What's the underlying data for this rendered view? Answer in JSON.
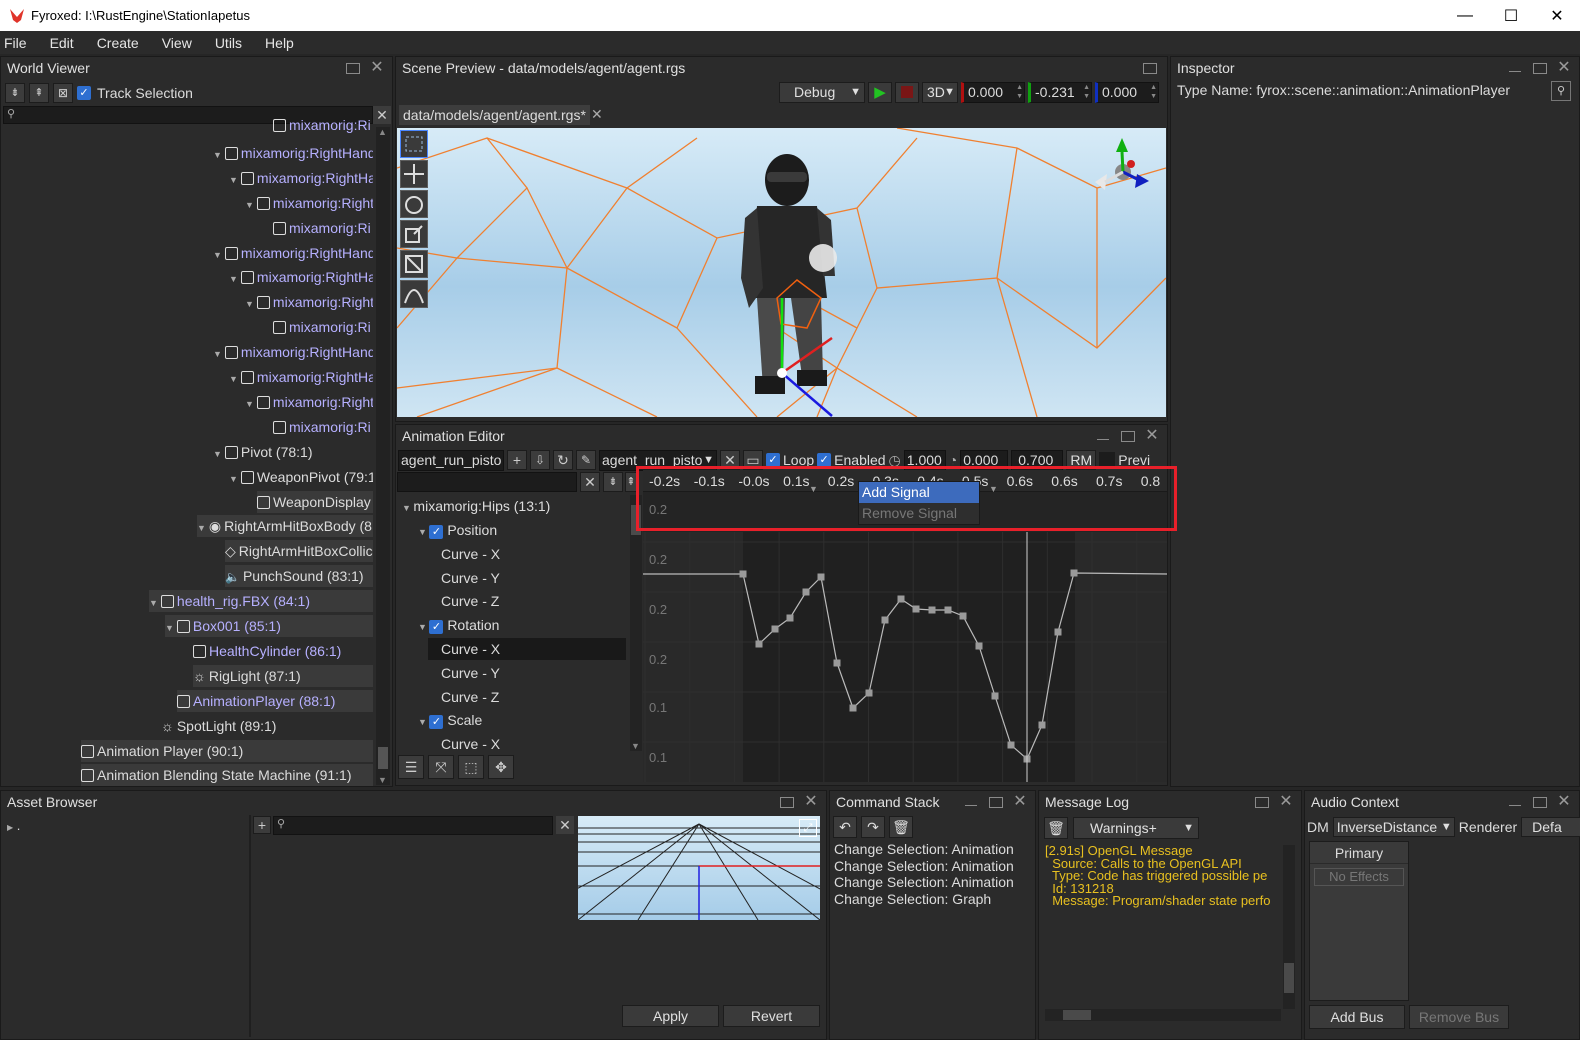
{
  "window": {
    "title": "Fyroxed: I:\\RustEngine\\StationIapetus",
    "min": "—",
    "max": "☐",
    "close": "✕"
  },
  "menu": [
    "File",
    "Edit",
    "Create",
    "View",
    "Utils",
    "Help"
  ],
  "world_viewer": {
    "title": "World Viewer",
    "track_selection": "Track Selection",
    "items": [
      {
        "label": "mixamorig:Ri",
        "indent": 272,
        "arrow": false,
        "violet": true,
        "icon": "cube"
      },
      {
        "label": "mixamorig:RightHand",
        "indent": 224,
        "arrow": true,
        "violet": true,
        "icon": "cube"
      },
      {
        "label": "mixamorig:RightHa",
        "indent": 240,
        "arrow": true,
        "violet": true,
        "icon": "cube"
      },
      {
        "label": "mixamorig:Right",
        "indent": 256,
        "arrow": true,
        "violet": true,
        "icon": "cube"
      },
      {
        "label": "mixamorig:Ri",
        "indent": 272,
        "arrow": false,
        "violet": true,
        "icon": "cube"
      },
      {
        "label": "mixamorig:RightHand",
        "indent": 224,
        "arrow": true,
        "violet": true,
        "icon": "cube"
      },
      {
        "label": "mixamorig:RightHa",
        "indent": 240,
        "arrow": true,
        "violet": true,
        "icon": "cube"
      },
      {
        "label": "mixamorig:Right",
        "indent": 256,
        "arrow": true,
        "violet": true,
        "icon": "cube"
      },
      {
        "label": "mixamorig:Ri",
        "indent": 272,
        "arrow": false,
        "violet": true,
        "icon": "cube"
      },
      {
        "label": "mixamorig:RightHand",
        "indent": 224,
        "arrow": true,
        "violet": true,
        "icon": "cube"
      },
      {
        "label": "mixamorig:RightHa",
        "indent": 240,
        "arrow": true,
        "violet": true,
        "icon": "cube"
      },
      {
        "label": "mixamorig:Right",
        "indent": 256,
        "arrow": true,
        "violet": true,
        "icon": "cube"
      },
      {
        "label": "mixamorig:Ri",
        "indent": 272,
        "arrow": false,
        "violet": true,
        "icon": "cube"
      },
      {
        "label": "Pivot (78:1)",
        "indent": 224,
        "arrow": true,
        "violet": false,
        "icon": "cube"
      },
      {
        "label": "WeaponPivot (79:1",
        "indent": 240,
        "arrow": true,
        "violet": false,
        "icon": "cube"
      },
      {
        "label": "WeaponDisplay",
        "indent": 256,
        "arrow": false,
        "violet": false,
        "icon": "cube"
      },
      {
        "label": "RightArmHitBoxBody (8",
        "indent": 208,
        "arrow": true,
        "violet": false,
        "icon": "body"
      },
      {
        "label": "RightArmHitBoxCollic",
        "indent": 224,
        "arrow": false,
        "violet": false,
        "icon": "collider"
      },
      {
        "label": "PunchSound (83:1)",
        "indent": 224,
        "arrow": false,
        "violet": false,
        "icon": "sound"
      },
      {
        "label": "health_rig.FBX (84:1)",
        "indent": 160,
        "arrow": true,
        "violet": true,
        "icon": "cube"
      },
      {
        "label": "Box001 (85:1)",
        "indent": 176,
        "arrow": true,
        "violet": true,
        "icon": "cube"
      },
      {
        "label": "HealthCylinder (86:1)",
        "indent": 192,
        "arrow": false,
        "violet": true,
        "icon": "cube"
      },
      {
        "label": "RigLight (87:1)",
        "indent": 192,
        "arrow": false,
        "violet": false,
        "icon": "light"
      },
      {
        "label": "AnimationPlayer (88:1)",
        "indent": 176,
        "arrow": false,
        "violet": true,
        "icon": "cube"
      },
      {
        "label": "SpotLight (89:1)",
        "indent": 160,
        "arrow": false,
        "violet": false,
        "icon": "light"
      },
      {
        "label": "Animation Player (90:1)",
        "indent": 80,
        "arrow": false,
        "violet": false,
        "icon": "cube"
      },
      {
        "label": "Animation Blending State Machine (91:1)",
        "indent": 80,
        "arrow": false,
        "violet": false,
        "icon": "cube"
      }
    ]
  },
  "scene_preview": {
    "title": "Scene Preview - data/models/agent/agent.rgs",
    "mode": "Debug",
    "projection": "3D",
    "x": "0.000",
    "y": "-0.231",
    "z": "0.000",
    "tab": "data/models/agent/agent.rgs*"
  },
  "inspector": {
    "title": "Inspector",
    "type_name": "Type Name: fyrox::scene::animation::AnimationPlayer"
  },
  "animation_editor": {
    "title": "Animation Editor",
    "anim_name": "agent_run_pisto",
    "anim_select": "agent_run_pisto",
    "loop": "Loop",
    "enabled": "Enabled",
    "speed": "1.000",
    "time_start": "0.000",
    "time_end": "0.700",
    "rm": "RM",
    "preview": "Previ",
    "ticks": [
      "-0.2s",
      "-0.1s",
      "-0.0s",
      "0.1s",
      "0.2s",
      "0.3s",
      "0.4s",
      "0.5s",
      "0.6s",
      "0.6s",
      "0.7s",
      "0.8"
    ],
    "track_tree": [
      {
        "label": "mixamorig:Hips (13:1)",
        "kind": "root"
      },
      {
        "label": "Position",
        "kind": "group"
      },
      {
        "label": "Curve - X",
        "kind": "curve"
      },
      {
        "label": "Curve - Y",
        "kind": "curve"
      },
      {
        "label": "Curve - Z",
        "kind": "curve"
      },
      {
        "label": "Rotation",
        "kind": "group"
      },
      {
        "label": "Curve - X",
        "kind": "curve",
        "selected": true
      },
      {
        "label": "Curve - Y",
        "kind": "curve"
      },
      {
        "label": "Curve - Z",
        "kind": "curve"
      },
      {
        "label": "Scale",
        "kind": "group"
      },
      {
        "label": "Curve - X",
        "kind": "curve"
      }
    ],
    "y_labels": [
      "0.2",
      "0.2",
      "0.2",
      "0.2",
      "0.1",
      "0.1"
    ],
    "context_menu": {
      "add": "Add Signal",
      "remove": "Remove Signal"
    }
  },
  "asset_browser": {
    "title": "Asset Browser",
    "root": ".",
    "apply": "Apply",
    "revert": "Revert"
  },
  "command_stack": {
    "title": "Command Stack",
    "items": [
      "Change Selection: Animation",
      "Change Selection: Animation",
      "Change Selection: Animation",
      "Change Selection: Graph"
    ]
  },
  "message_log": {
    "title": "Message Log",
    "filter": "Warnings+",
    "lines": [
      "[2.91s] OpenGL Message",
      "  Source: Calls to the OpenGL API",
      "  Type: Code has triggered possible pe",
      "  Id: 131218",
      "  Message: Program/shader state perfo"
    ]
  },
  "audio_context": {
    "title": "Audio Context",
    "dm_label": "DM",
    "dm_value": "InverseDistance",
    "renderer_label": "Renderer",
    "renderer_value": "Defa",
    "bus": "Primary",
    "no_effects": "No Effects",
    "add_bus": "Add Bus",
    "remove_bus": "Remove Bus"
  },
  "colors": {
    "accent": "#2e6fd1",
    "highlight_box": "#e8202a",
    "violet_text": "#b6b0ff",
    "log_text": "#e8c020",
    "play": "#22c322",
    "stop": "#a01c1c",
    "wire": "#f08030"
  }
}
